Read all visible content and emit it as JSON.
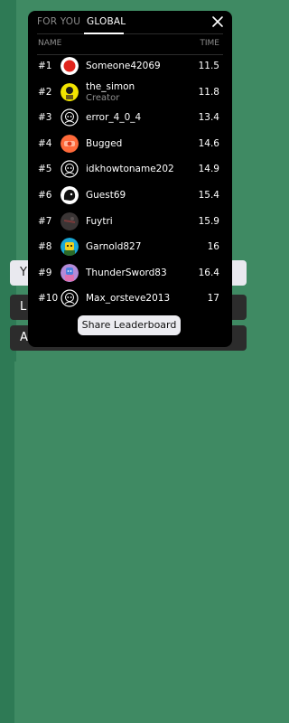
{
  "tabs": [
    {
      "label": "FOR YOU",
      "active": false
    },
    {
      "label": "GLOBAL",
      "active": true
    }
  ],
  "columns": {
    "name": "NAME",
    "time": "TIME"
  },
  "rows": [
    {
      "rank": "#1",
      "name": "Someone42069",
      "sub": "",
      "time": "11.5",
      "avatar": "red-dot-avatar"
    },
    {
      "rank": "#2",
      "name": "the_simon",
      "sub": "Creator",
      "time": "11.8",
      "avatar": "yellow-face-avatar"
    },
    {
      "rank": "#3",
      "name": "error_4_0_4",
      "sub": "",
      "time": "13.4",
      "avatar": "outline-face-avatar"
    },
    {
      "rank": "#4",
      "name": "Bugged",
      "sub": "",
      "time": "14.6",
      "avatar": "orange-red-avatar"
    },
    {
      "rank": "#5",
      "name": "idkhowtoname202",
      "sub": "",
      "time": "14.9",
      "avatar": "outline-face-avatar"
    },
    {
      "rank": "#6",
      "name": "Guest69",
      "sub": "",
      "time": "15.4",
      "avatar": "black-blob-avatar"
    },
    {
      "rank": "#7",
      "name": "Fuytri",
      "sub": "",
      "time": "15.9",
      "avatar": "dark-gray-avatar"
    },
    {
      "rank": "#8",
      "name": "Garnold827",
      "sub": "",
      "time": "16",
      "avatar": "cyan-yellow-avatar"
    },
    {
      "rank": "#9",
      "name": "ThunderSword83",
      "sub": "",
      "time": "16.4",
      "avatar": "purple-blue-avatar"
    },
    {
      "rank": "#10",
      "name": "Max_orsteve2013",
      "sub": "",
      "time": "17",
      "avatar": "outline-face-avatar"
    }
  ],
  "share_button": "Share Leaderboard",
  "background_buttons": [
    "Y",
    "L",
    "A"
  ]
}
